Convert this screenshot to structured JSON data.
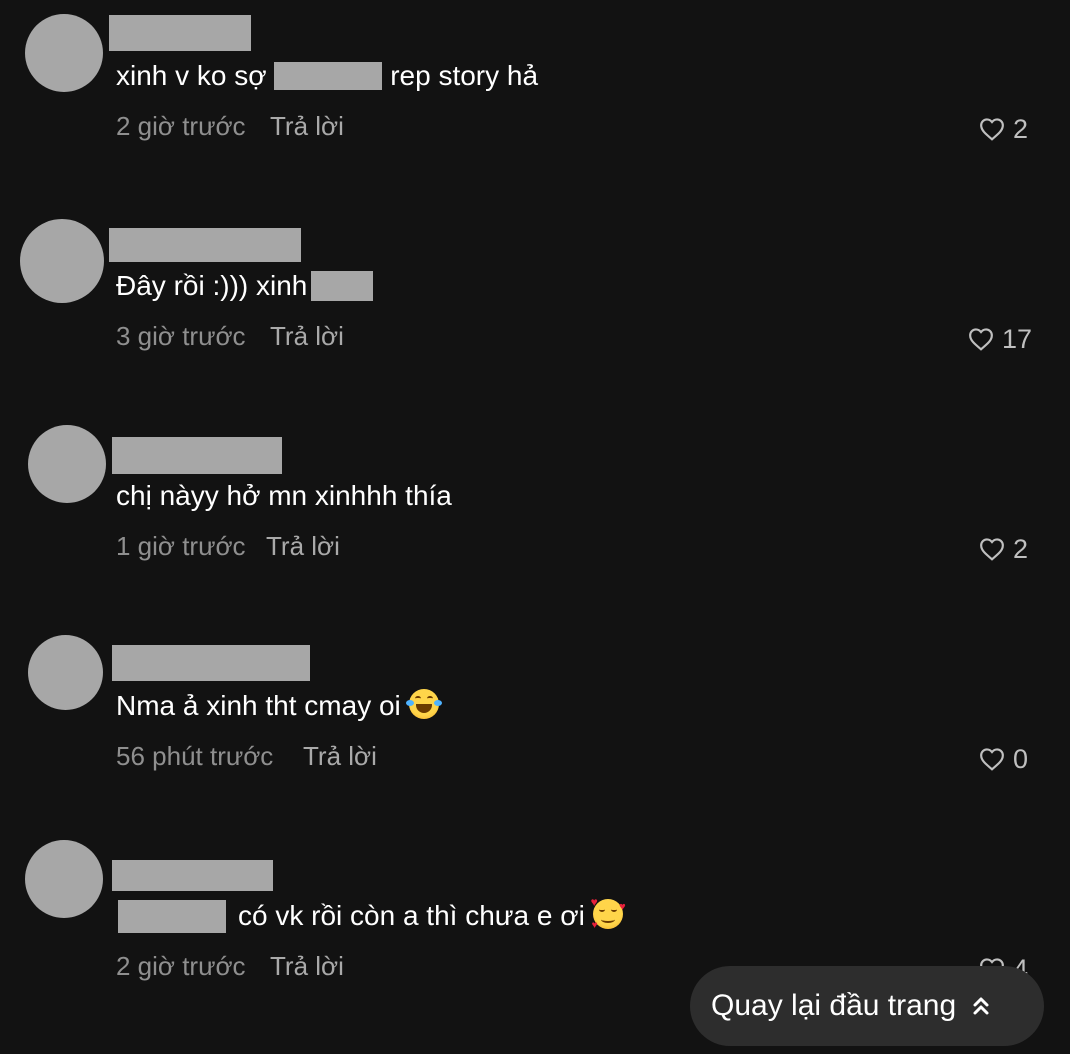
{
  "comments": [
    {
      "text": "xinh v ko sợ",
      "text_after": "rep story hả",
      "time": "2 giờ trước",
      "reply": "Trả lời",
      "likes": "2"
    },
    {
      "text": "Đây rồi :))) xinh",
      "time": "3 giờ trước",
      "reply": "Trả lời",
      "likes": "17"
    },
    {
      "text": "chị nàyy hở mn xinhhh thía",
      "time": "1 giờ trước",
      "reply": "Trả lời",
      "likes": "2"
    },
    {
      "text": "Nma ả xinh tht cmay oi",
      "emoji": "tears-of-joy-emoji",
      "time": "56 phút trước",
      "reply": "Trả lời",
      "likes": "0"
    },
    {
      "text": "có vk rồi còn a thì chưa e ơi",
      "emoji": "smiling-face-with-hearts-emoji",
      "time": "2 giờ trước",
      "reply": "Trả lời",
      "likes": "4"
    }
  ],
  "back_to_top": {
    "label": "Quay lại đầu trang",
    "icon": "double-chevron-up-icon"
  },
  "colors": {
    "background": "#121212",
    "avatar": "#a7a7a7",
    "pill": "#2d2d2d",
    "meta": "#8f8f8f"
  }
}
